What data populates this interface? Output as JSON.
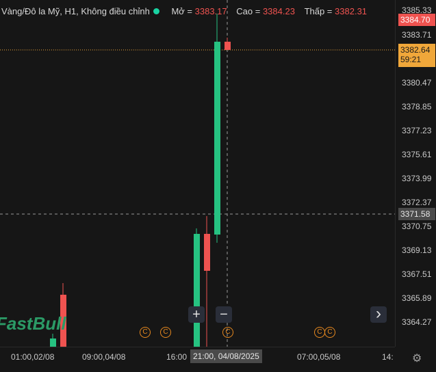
{
  "legend": {
    "symbol": "Vàng/Đô la Mỹ, H1, Không điều chỉnh",
    "open_label": "Mở =",
    "open_value": "3383.17",
    "high_label": "Cao =",
    "high_value": "3384.23",
    "low_label": "Thấp =",
    "low_value": "3382.31",
    "status_color": "#19d3a2"
  },
  "price_axis": {
    "ticks": [
      "3385.33",
      "3383.71",
      "3380.47",
      "3378.85",
      "3377.23",
      "3375.61",
      "3373.99",
      "3372.37",
      "3370.75",
      "3369.13",
      "3367.51",
      "3365.89",
      "3364.27"
    ],
    "last_price_tag": "3384.70",
    "current_price_tag": "3382.64",
    "countdown": "59:21",
    "crosshair_price": "3371.58"
  },
  "time_axis": {
    "labels": [
      "01:00,02/08",
      "09:00,04/08",
      "16:00",
      "07:00,05/08",
      "14:"
    ],
    "crosshair_time": "21:00, 04/08/2025"
  },
  "buttons": {
    "zoom_in": "+",
    "zoom_out": "−",
    "scroll_right": "›"
  },
  "watermark": "FastBull",
  "event_marker": "C",
  "colors": {
    "up": "#26c281",
    "down": "#ef5350",
    "price_line": "#f0a73a"
  }
}
